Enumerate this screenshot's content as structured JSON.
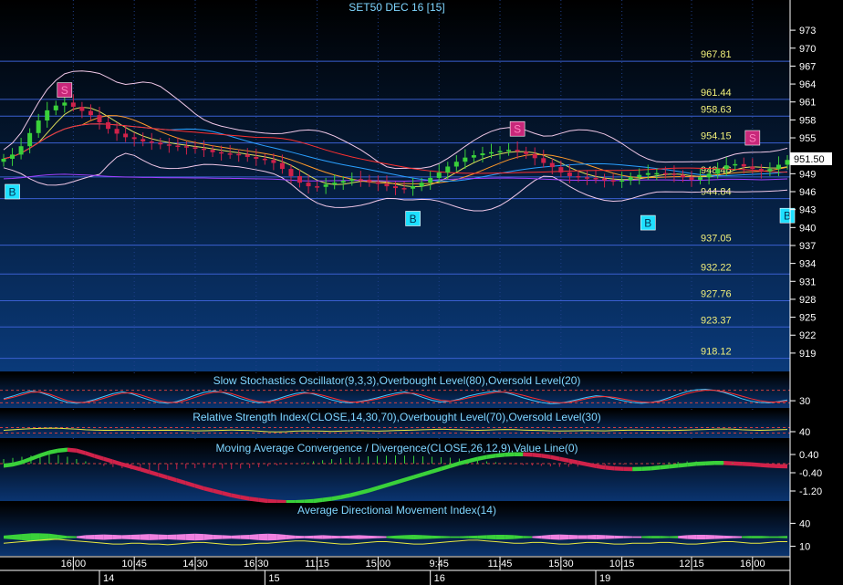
{
  "colors": {
    "bg_top": "#000000",
    "bg_bottom": "#08306b",
    "grid": "#1f3f8a",
    "hline": "#3a5fd0",
    "axis_text": "#ffffff",
    "level_text": "#f2f07a",
    "title_text": "#7fd6ff",
    "bull": "#3ad13a",
    "bear": "#d0224a",
    "buy": "#1ee0ff",
    "sell": "#c8287a"
  },
  "chart_data": [
    {
      "type": "candlestick",
      "title": "SET50 DEC 16   [15]",
      "ylim": [
        917,
        975
      ],
      "price_ticks": [
        973,
        970,
        967,
        964,
        961,
        958,
        955,
        952,
        949,
        946,
        943,
        940,
        937,
        934,
        931,
        928,
        925,
        922,
        919
      ],
      "levels": [
        {
          "label": "967.81",
          "value": 967.81
        },
        {
          "label": "961.44",
          "value": 961.44
        },
        {
          "label": "958.63",
          "value": 958.63
        },
        {
          "label": "954.15",
          "value": 954.15
        },
        {
          "label": "948.46",
          "value": 948.46
        },
        {
          "label": "944.84",
          "value": 944.84
        },
        {
          "label": "937.05",
          "value": 937.05
        },
        {
          "label": "932.22",
          "value": 932.22
        },
        {
          "label": "927.76",
          "value": 927.76
        },
        {
          "label": "923.37",
          "value": 923.37
        },
        {
          "label": "918.12",
          "value": 918.12
        }
      ],
      "last_price": "951.50",
      "last_value": 951.5,
      "closes": [
        951.5,
        952.2,
        953.6,
        955.8,
        957.9,
        959.6,
        960.4,
        960.9,
        960.2,
        959.5,
        958.8,
        957.6,
        956.5,
        955.7,
        955.1,
        954.8,
        954.4,
        954.2,
        953.9,
        953.7,
        953.6,
        953.4,
        953.2,
        953.0,
        952.6,
        952.4,
        952.3,
        952.2,
        951.8,
        951.5,
        951.3,
        950.8,
        949.8,
        948.6,
        947.5,
        946.9,
        946.8,
        947.2,
        947.5,
        947.8,
        948.1,
        948.0,
        947.6,
        947.3,
        946.9,
        946.6,
        946.5,
        946.9,
        947.5,
        948.3,
        949.2,
        950.2,
        951.0,
        951.7,
        952.1,
        952.4,
        952.6,
        952.8,
        953.0,
        952.7,
        952.3,
        951.6,
        950.8,
        950.1,
        949.2,
        948.6,
        948.4,
        948.3,
        948.2,
        947.9,
        947.8,
        947.9,
        948.4,
        948.8,
        949.1,
        949.1,
        949.0,
        948.8,
        948.4,
        948.0,
        948.4,
        949.0,
        949.8,
        950.4,
        950.6,
        950.2,
        949.8,
        949.4,
        949.8,
        950.5,
        951.3
      ],
      "markers": [
        {
          "label": "B",
          "kind": "buy",
          "index": 1,
          "value": 946.0
        },
        {
          "label": "S",
          "kind": "sell",
          "index": 7,
          "value": 963.0
        },
        {
          "label": "B",
          "kind": "buy",
          "index": 47,
          "value": 941.5
        },
        {
          "label": "S",
          "kind": "sell",
          "index": 59,
          "value": 956.5
        },
        {
          "label": "B",
          "kind": "buy",
          "index": 74,
          "value": 940.8
        },
        {
          "label": "S",
          "kind": "sell",
          "index": 86,
          "value": 955.0
        },
        {
          "label": "B",
          "kind": "buy",
          "index": 90,
          "value": 942.0
        }
      ],
      "x_labels": [
        "16:00",
        "10:45",
        "14:30",
        "16:30",
        "11:15",
        "15:00",
        "9:45",
        "11:45",
        "15:30",
        "10:15",
        "12:15",
        "16:00"
      ],
      "x_label_index": [
        8,
        15,
        22,
        29,
        36,
        43,
        50,
        57,
        64,
        71,
        79,
        86
      ],
      "day_labels": [
        "14",
        "15",
        "16",
        "19"
      ],
      "day_index": [
        11,
        30,
        49,
        68
      ]
    },
    {
      "type": "line",
      "title": "Slow Stochastics Oscillator(9,3,3),Overbought Level(80),Oversold Level(20)",
      "ylim": [
        0,
        100
      ],
      "ticks": [
        "30"
      ],
      "tick_values": [
        30
      ],
      "levels": [
        80,
        20
      ],
      "series": [
        {
          "values": [
            40,
            52,
            66,
            76,
            70,
            55,
            36,
            22,
            18,
            24,
            36,
            50,
            64,
            72,
            64,
            48,
            34,
            22,
            18,
            26,
            40,
            56,
            70,
            76,
            70,
            56,
            40,
            28,
            20,
            26,
            38,
            52,
            64,
            70,
            62,
            48,
            34,
            24,
            20,
            26,
            34,
            44,
            56,
            66,
            72,
            62,
            46,
            32,
            24,
            28,
            38,
            52,
            62,
            70,
            76,
            70,
            58,
            44,
            32,
            22,
            16,
            18,
            26,
            36,
            46,
            54,
            50,
            40,
            30,
            22,
            18,
            22,
            30,
            44,
            60,
            74,
            82,
            84,
            80,
            70,
            56,
            40,
            28,
            22,
            20,
            26,
            34
          ]
        },
        {
          "values": [
            36,
            46,
            58,
            70,
            72,
            62,
            46,
            30,
            22,
            22,
            30,
            42,
            56,
            66,
            68,
            58,
            44,
            30,
            22,
            22,
            32,
            46,
            60,
            70,
            72,
            64,
            50,
            36,
            26,
            24,
            32,
            44,
            56,
            66,
            66,
            56,
            44,
            32,
            24,
            24,
            30,
            38,
            48,
            58,
            66,
            66,
            56,
            42,
            32,
            28,
            34,
            44,
            54,
            62,
            70,
            72,
            66,
            56,
            44,
            34,
            24,
            20,
            22,
            30,
            40,
            48,
            50,
            46,
            38,
            30,
            24,
            22,
            26,
            36,
            50,
            64,
            74,
            80,
            80,
            74,
            64,
            52,
            40,
            30,
            24,
            24,
            28
          ]
        }
      ]
    },
    {
      "type": "line",
      "title": "Relative Strength Index(CLOSE,14,30,70),Overbought Level(70),Oversold Level(30)",
      "ylim": [
        0,
        100
      ],
      "ticks": [
        "40"
      ],
      "tick_values": [
        40
      ],
      "levels": [
        70,
        30
      ],
      "series": [
        {
          "values": [
            50,
            54,
            58,
            62,
            64,
            66,
            65,
            62,
            58,
            54,
            52,
            50,
            50,
            52,
            51,
            50,
            49,
            50,
            51,
            50,
            48,
            46,
            47,
            48,
            50,
            52,
            50,
            48,
            44,
            40,
            38,
            40,
            44,
            46,
            45,
            44,
            42,
            44,
            46,
            48,
            46,
            44,
            46,
            48,
            50,
            52,
            54,
            56,
            58,
            56,
            54,
            52,
            50,
            52,
            54,
            56,
            55,
            52,
            50,
            48,
            46,
            45,
            46,
            47,
            48,
            47,
            46,
            48,
            50,
            52,
            51,
            50,
            49,
            48,
            50,
            52,
            54,
            56,
            58,
            60,
            58,
            54,
            52,
            50,
            52,
            54,
            56
          ]
        }
      ]
    },
    {
      "type": "histogram",
      "title": "Moving Average Convergence / Divergence(CLOSE,26,12,9),Value Line(0)",
      "ylim": [
        -1.6,
        1.0
      ],
      "ticks": [
        "0.40",
        "-0.40",
        "-1.20"
      ],
      "tick_values": [
        0.4,
        -0.4,
        -1.2
      ],
      "levels": [
        0
      ],
      "macd": [
        0.0,
        0.05,
        0.15,
        0.3,
        0.45,
        0.58,
        0.66,
        0.7,
        0.66,
        0.55,
        0.42,
        0.3,
        0.18,
        0.06,
        -0.05,
        -0.16,
        -0.28,
        -0.4,
        -0.52,
        -0.64,
        -0.76,
        -0.88,
        -1.0,
        -1.1,
        -1.2,
        -1.3,
        -1.38,
        -1.45,
        -1.5,
        -1.55,
        -1.58,
        -1.6,
        -1.6,
        -1.58,
        -1.55,
        -1.5,
        -1.45,
        -1.38,
        -1.3,
        -1.2,
        -1.1,
        -0.98,
        -0.86,
        -0.74,
        -0.62,
        -0.5,
        -0.38,
        -0.26,
        -0.14,
        -0.02,
        0.1,
        0.2,
        0.3,
        0.38,
        0.44,
        0.48,
        0.5,
        0.5,
        0.48,
        0.44,
        0.38,
        0.3,
        0.22,
        0.14,
        0.06,
        -0.02,
        -0.08,
        -0.12,
        -0.14,
        -0.15,
        -0.14,
        -0.12,
        -0.08,
        -0.04,
        0.0,
        0.04,
        0.08,
        0.1,
        0.12,
        0.12,
        0.1,
        0.08,
        0.06,
        0.03,
        0.0,
        -0.02,
        -0.03
      ],
      "hist": [
        0.2,
        0.25,
        0.3,
        0.35,
        0.4,
        0.42,
        0.38,
        0.3,
        0.2,
        0.1,
        0.0,
        -0.1,
        -0.15,
        -0.2,
        -0.25,
        -0.28,
        -0.3,
        -0.3,
        -0.28,
        -0.25,
        -0.22,
        -0.2,
        -0.18,
        -0.2,
        -0.22,
        -0.24,
        -0.22,
        -0.2,
        -0.16,
        -0.12,
        -0.08,
        -0.04,
        0.0,
        0.05,
        0.1,
        0.15,
        0.2,
        0.24,
        0.28,
        0.3,
        0.32,
        0.34,
        0.35,
        0.36,
        0.35,
        0.34,
        0.32,
        0.3,
        0.28,
        0.26,
        0.22,
        0.18,
        0.14,
        0.1,
        0.06,
        0.02,
        -0.02,
        -0.06,
        -0.08,
        -0.1,
        -0.12,
        -0.14,
        -0.14,
        -0.13,
        -0.12,
        -0.1,
        -0.08,
        -0.06,
        -0.04,
        -0.02,
        0.0,
        0.02,
        0.04,
        0.06,
        0.08,
        0.1,
        0.1,
        0.09,
        0.08,
        0.06,
        0.04,
        0.02,
        0.0,
        -0.02,
        -0.03,
        -0.04,
        -0.05
      ]
    },
    {
      "type": "area",
      "title": "Average Directional Movement Index(14)",
      "ylim": [
        0,
        50
      ],
      "ticks": [
        "40",
        "10"
      ],
      "tick_values": [
        40,
        10
      ],
      "adx": [
        26,
        27,
        28,
        29,
        30,
        31,
        31,
        30,
        29,
        28,
        27,
        26,
        25,
        25,
        26,
        26,
        25,
        25,
        24,
        25,
        26,
        27,
        27,
        26,
        25,
        24,
        24,
        25,
        26,
        26,
        27,
        28,
        29,
        29,
        28,
        27,
        26,
        25,
        25,
        26,
        27,
        28,
        28,
        27,
        26,
        25,
        25,
        26,
        27,
        28,
        29,
        30,
        30,
        29,
        28,
        27,
        26,
        26,
        27,
        27,
        26,
        25,
        25,
        26,
        27,
        27,
        26,
        25,
        25,
        26,
        26,
        26,
        27,
        27,
        26,
        25,
        25,
        26,
        27,
        28,
        28,
        27,
        26,
        26,
        27,
        28,
        28
      ],
      "diff": [
        4,
        6,
        8,
        10,
        10,
        9,
        6,
        3,
        -2,
        -5,
        -6,
        -7,
        -6,
        -5,
        -6,
        -7,
        -8,
        -7,
        -6,
        -7,
        -8,
        -9,
        -8,
        -6,
        -5,
        -4,
        -5,
        -6,
        -8,
        -9,
        -8,
        -6,
        -4,
        -3,
        -4,
        -5,
        -4,
        -3,
        -4,
        -5,
        -4,
        -3,
        2,
        4,
        5,
        6,
        5,
        4,
        3,
        2,
        2,
        3,
        4,
        5,
        6,
        6,
        5,
        3,
        -2,
        -4,
        -6,
        -7,
        -6,
        -5,
        -5,
        -6,
        -5,
        -4,
        -3,
        -2,
        2,
        3,
        3,
        2,
        -3,
        -5,
        -6,
        -6,
        -5,
        -4,
        -3,
        2,
        3,
        3,
        2,
        2,
        3
      ]
    }
  ]
}
